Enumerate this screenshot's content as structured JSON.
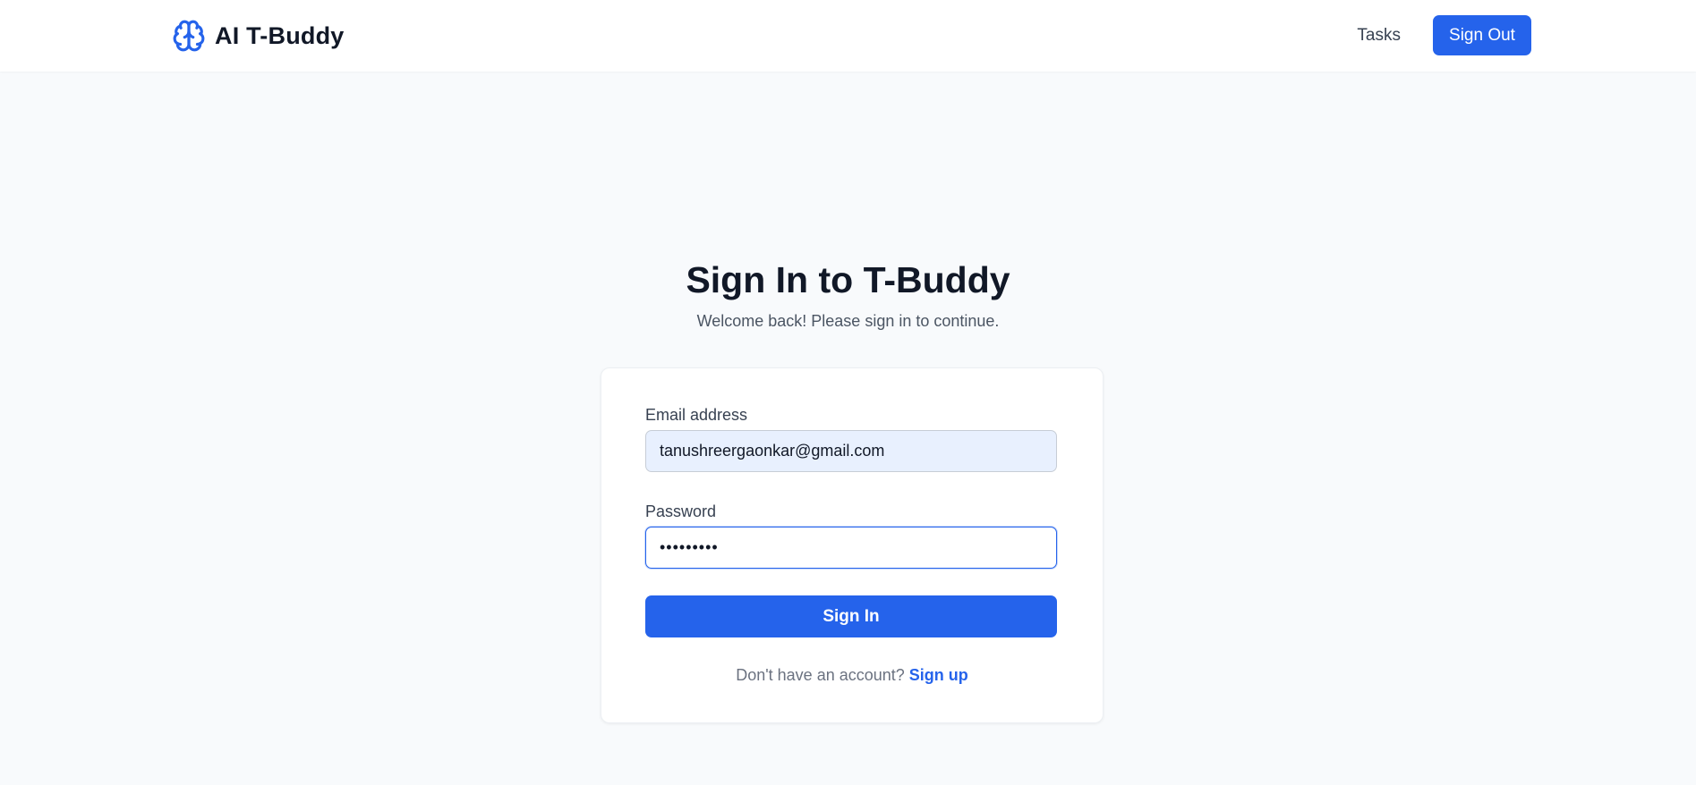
{
  "header": {
    "brand_icon": "brain-icon",
    "brand_name": "AI T-Buddy",
    "nav_tasks": "Tasks",
    "signout_label": "Sign Out"
  },
  "main": {
    "title": "Sign In to T-Buddy",
    "subtitle": "Welcome back! Please sign in to continue."
  },
  "form": {
    "email_label": "Email address",
    "email_value": "tanushreergaonkar@gmail.com",
    "password_label": "Password",
    "password_value": "•••••••••",
    "submit_label": "Sign In",
    "signup_prompt": "Don't have an account?",
    "signup_link": "Sign up"
  },
  "colors": {
    "accent": "#2563eb",
    "background": "#f8fafc",
    "card": "#ffffff",
    "email_autofill_bg": "#e8f0fe"
  }
}
